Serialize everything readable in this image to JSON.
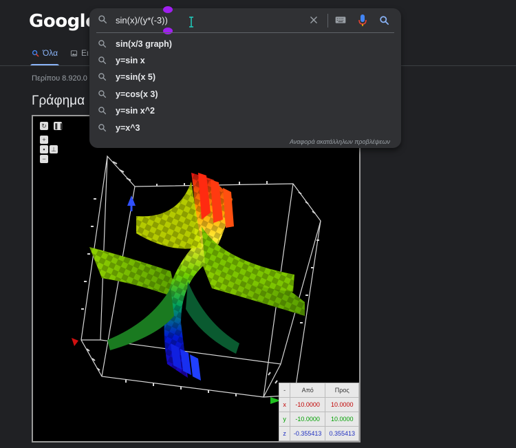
{
  "logo": "Google",
  "search": {
    "query": "sin(x)/(y*(-3))",
    "suggestions": [
      "sin(x/3 graph)",
      "y=sin x",
      "y=sin(x 5)",
      "y=cos(x 3)",
      "y=sin x^2",
      "y=x^3"
    ],
    "report_label": "Αναφορά ακατάλληλων προβλέψεων"
  },
  "tabs": [
    {
      "label": "Όλα",
      "active": true
    },
    {
      "label": "Ει",
      "active": false
    }
  ],
  "result_stats": "Περίπου 8.920.0",
  "graph": {
    "title": "Γράφημα ",
    "range_table": {
      "headers": [
        "-",
        "Από",
        "Προς"
      ],
      "rows": [
        {
          "axis": "x",
          "from": "-10.0000",
          "to": "10.0000"
        },
        {
          "axis": "y",
          "from": "-10.0000",
          "to": "10.0000"
        },
        {
          "axis": "z",
          "from": "-0.355413",
          "to": "0.355413"
        }
      ]
    },
    "controls": [
      "+",
      "−"
    ]
  },
  "colors": {
    "background": "#202124",
    "accent": "#8ab4f8",
    "axis_x": "#c00000",
    "axis_y": "#00a000",
    "axis_z": "#2030c0"
  }
}
